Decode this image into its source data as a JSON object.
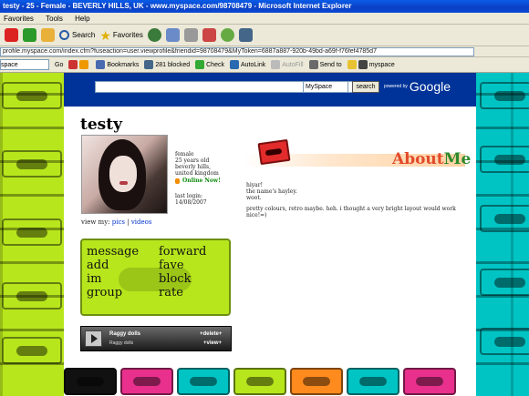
{
  "browser": {
    "title": "testy - 25 - Female - BEVERLY HILLS, UK - www.myspace.com/98708479 - Microsoft Internet Explorer",
    "menu": [
      "Favorites",
      "Tools",
      "Help"
    ],
    "toolbar": {
      "search": "Search",
      "favorites": "Favorites"
    },
    "address": "profile.myspace.com/index.cfm?fuseaction=user.viewprofile&friendid=98708479&MyToken=6887a887-920b-49bd-a69f-f76fef4785d7",
    "links": {
      "space": "space",
      "go": "Go",
      "bookmarks": "Bookmarks",
      "blocked": "281 blocked",
      "check": "Check",
      "autolink": "AutoLink",
      "autofill": "AutoFill",
      "sendto": "Send to",
      "myspace": "myspace"
    }
  },
  "search": {
    "select": "MySpace",
    "button": "search",
    "powered_by": "powered by",
    "brand": "Google"
  },
  "profile": {
    "name": "testy",
    "info": [
      "female",
      "25 years old",
      "beverly hills,",
      "united kingdom"
    ],
    "online": "Online Now!",
    "last_login_label": "last login:",
    "last_login": "14/08/2007",
    "view_my": "view my:",
    "pics": "pics",
    "separator": "|",
    "videos": "videos"
  },
  "contact": {
    "message": "message",
    "forward": "forward",
    "add": "add",
    "fave": "fave",
    "im": "im",
    "block": "block",
    "group": "group",
    "rate": "rate"
  },
  "player": {
    "song": "Raggy dolls",
    "artist": "Raggy dolls",
    "delete": "+delete+",
    "view": "+view+"
  },
  "about": {
    "title_about": "About",
    "title_me": "Me",
    "paragraphs": [
      "hiyar!",
      "the name's hayley.",
      "woot.",
      "pretty colours, retro maybe. heh. i thought a very bright layout would work nice!=)"
    ]
  },
  "colors": {
    "titlebar": "#0a4ad6",
    "googlebar": "#003399",
    "lime": "#b7e61c",
    "cyan": "#00c4c4",
    "orange": "#ff8a1e",
    "about_red": "#e24a2a",
    "about_green": "#2c8a2c"
  }
}
